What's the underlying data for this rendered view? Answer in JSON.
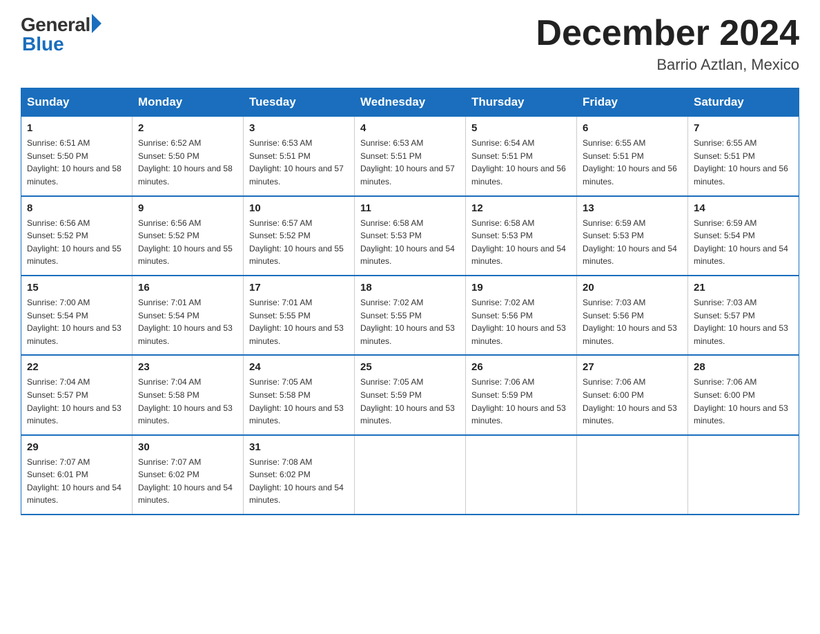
{
  "logo": {
    "general": "General",
    "blue": "Blue"
  },
  "title": "December 2024",
  "subtitle": "Barrio Aztlan, Mexico",
  "weekdays": [
    "Sunday",
    "Monday",
    "Tuesday",
    "Wednesday",
    "Thursday",
    "Friday",
    "Saturday"
  ],
  "weeks": [
    [
      {
        "day": 1,
        "sunrise": "6:51 AM",
        "sunset": "5:50 PM",
        "daylight": "10 hours and 58 minutes."
      },
      {
        "day": 2,
        "sunrise": "6:52 AM",
        "sunset": "5:50 PM",
        "daylight": "10 hours and 58 minutes."
      },
      {
        "day": 3,
        "sunrise": "6:53 AM",
        "sunset": "5:51 PM",
        "daylight": "10 hours and 57 minutes."
      },
      {
        "day": 4,
        "sunrise": "6:53 AM",
        "sunset": "5:51 PM",
        "daylight": "10 hours and 57 minutes."
      },
      {
        "day": 5,
        "sunrise": "6:54 AM",
        "sunset": "5:51 PM",
        "daylight": "10 hours and 56 minutes."
      },
      {
        "day": 6,
        "sunrise": "6:55 AM",
        "sunset": "5:51 PM",
        "daylight": "10 hours and 56 minutes."
      },
      {
        "day": 7,
        "sunrise": "6:55 AM",
        "sunset": "5:51 PM",
        "daylight": "10 hours and 56 minutes."
      }
    ],
    [
      {
        "day": 8,
        "sunrise": "6:56 AM",
        "sunset": "5:52 PM",
        "daylight": "10 hours and 55 minutes."
      },
      {
        "day": 9,
        "sunrise": "6:56 AM",
        "sunset": "5:52 PM",
        "daylight": "10 hours and 55 minutes."
      },
      {
        "day": 10,
        "sunrise": "6:57 AM",
        "sunset": "5:52 PM",
        "daylight": "10 hours and 55 minutes."
      },
      {
        "day": 11,
        "sunrise": "6:58 AM",
        "sunset": "5:53 PM",
        "daylight": "10 hours and 54 minutes."
      },
      {
        "day": 12,
        "sunrise": "6:58 AM",
        "sunset": "5:53 PM",
        "daylight": "10 hours and 54 minutes."
      },
      {
        "day": 13,
        "sunrise": "6:59 AM",
        "sunset": "5:53 PM",
        "daylight": "10 hours and 54 minutes."
      },
      {
        "day": 14,
        "sunrise": "6:59 AM",
        "sunset": "5:54 PM",
        "daylight": "10 hours and 54 minutes."
      }
    ],
    [
      {
        "day": 15,
        "sunrise": "7:00 AM",
        "sunset": "5:54 PM",
        "daylight": "10 hours and 53 minutes."
      },
      {
        "day": 16,
        "sunrise": "7:01 AM",
        "sunset": "5:54 PM",
        "daylight": "10 hours and 53 minutes."
      },
      {
        "day": 17,
        "sunrise": "7:01 AM",
        "sunset": "5:55 PM",
        "daylight": "10 hours and 53 minutes."
      },
      {
        "day": 18,
        "sunrise": "7:02 AM",
        "sunset": "5:55 PM",
        "daylight": "10 hours and 53 minutes."
      },
      {
        "day": 19,
        "sunrise": "7:02 AM",
        "sunset": "5:56 PM",
        "daylight": "10 hours and 53 minutes."
      },
      {
        "day": 20,
        "sunrise": "7:03 AM",
        "sunset": "5:56 PM",
        "daylight": "10 hours and 53 minutes."
      },
      {
        "day": 21,
        "sunrise": "7:03 AM",
        "sunset": "5:57 PM",
        "daylight": "10 hours and 53 minutes."
      }
    ],
    [
      {
        "day": 22,
        "sunrise": "7:04 AM",
        "sunset": "5:57 PM",
        "daylight": "10 hours and 53 minutes."
      },
      {
        "day": 23,
        "sunrise": "7:04 AM",
        "sunset": "5:58 PM",
        "daylight": "10 hours and 53 minutes."
      },
      {
        "day": 24,
        "sunrise": "7:05 AM",
        "sunset": "5:58 PM",
        "daylight": "10 hours and 53 minutes."
      },
      {
        "day": 25,
        "sunrise": "7:05 AM",
        "sunset": "5:59 PM",
        "daylight": "10 hours and 53 minutes."
      },
      {
        "day": 26,
        "sunrise": "7:06 AM",
        "sunset": "5:59 PM",
        "daylight": "10 hours and 53 minutes."
      },
      {
        "day": 27,
        "sunrise": "7:06 AM",
        "sunset": "6:00 PM",
        "daylight": "10 hours and 53 minutes."
      },
      {
        "day": 28,
        "sunrise": "7:06 AM",
        "sunset": "6:00 PM",
        "daylight": "10 hours and 53 minutes."
      }
    ],
    [
      {
        "day": 29,
        "sunrise": "7:07 AM",
        "sunset": "6:01 PM",
        "daylight": "10 hours and 54 minutes."
      },
      {
        "day": 30,
        "sunrise": "7:07 AM",
        "sunset": "6:02 PM",
        "daylight": "10 hours and 54 minutes."
      },
      {
        "day": 31,
        "sunrise": "7:08 AM",
        "sunset": "6:02 PM",
        "daylight": "10 hours and 54 minutes."
      },
      null,
      null,
      null,
      null
    ]
  ]
}
